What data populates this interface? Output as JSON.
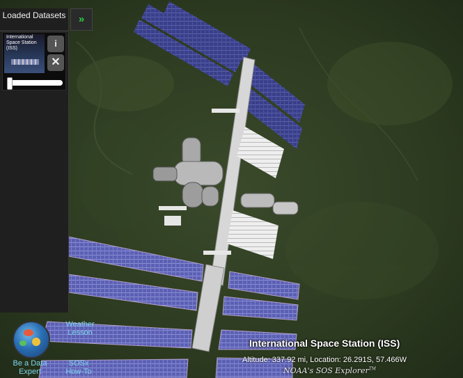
{
  "sidebar": {
    "header": "Loaded Datasets",
    "dataset": {
      "thumbnail_title": "International Space Station (ISS)",
      "info_icon": "info-icon",
      "close_icon": "close-icon"
    }
  },
  "expand_icon": "double-chevron-right-icon",
  "shortcuts": {
    "weather_lesson": "Weather Lesson",
    "be_a_data_expert": "Be a Data Expert",
    "sosx_howto": "SOSx How-To"
  },
  "caption": {
    "title": "International Space Station (ISS)",
    "info": "Altitude: 337.92 mi, Location: 26.291S, 57.466W",
    "brand": "NOAA's SOS Explorer",
    "brand_mark": "TM"
  },
  "colors": {
    "accent_green": "#2ecc40",
    "link_blue": "#7fd4ee",
    "panel_purple": "#6a6fc2"
  }
}
